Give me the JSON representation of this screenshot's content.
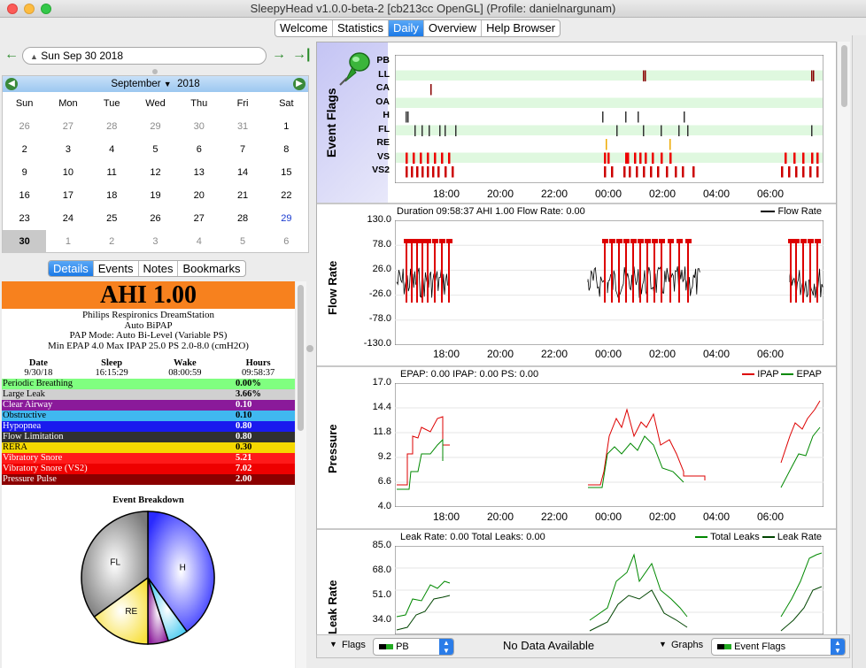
{
  "window": {
    "title": "SleepyHead v1.0.0-beta-2 [cb213cc OpenGL] (Profile: danielnargunam)"
  },
  "main_tabs": [
    "Welcome",
    "Statistics",
    "Daily",
    "Overview",
    "Help Browser"
  ],
  "main_tab_active": "Daily",
  "date_nav": {
    "date": "Sun Sep 30 2018",
    "prev_glyph": "←",
    "next_glyph": "→",
    "last_glyph": "→|"
  },
  "calendar": {
    "month": "September",
    "year": "2018",
    "days_of_week": [
      "Sun",
      "Mon",
      "Tue",
      "Wed",
      "Thu",
      "Fri",
      "Sat"
    ],
    "weeks": [
      [
        "26",
        "27",
        "28",
        "29",
        "30",
        "31",
        "1"
      ],
      [
        "2",
        "3",
        "4",
        "5",
        "6",
        "7",
        "8"
      ],
      [
        "9",
        "10",
        "11",
        "12",
        "13",
        "14",
        "15"
      ],
      [
        "16",
        "17",
        "18",
        "19",
        "20",
        "21",
        "22"
      ],
      [
        "23",
        "24",
        "25",
        "26",
        "27",
        "28",
        "29"
      ],
      [
        "30",
        "1",
        "2",
        "3",
        "4",
        "5",
        "6"
      ]
    ],
    "selected": "30"
  },
  "detail_tabs": [
    "Details",
    "Events",
    "Notes",
    "Bookmarks"
  ],
  "detail_tab_active": "Details",
  "details": {
    "ahi": "AHI 1.00",
    "machine": "Philips Respironics DreamStation",
    "model": "Auto BiPAP",
    "mode": "PAP Mode: Auto Bi-Level (Variable PS)",
    "settings": "Min EPAP 4.0 Max IPAP 25.0 PS 2.0-8.0 (cmH2O)",
    "stat_headers": [
      "Date",
      "Sleep",
      "Wake",
      "Hours"
    ],
    "stat_values": [
      "9/30/18",
      "16:15:29",
      "08:00:59",
      "09:58:37"
    ],
    "events": [
      {
        "label": "Periodic Breathing",
        "value": "0.00%",
        "bg": "#80ff80",
        "fg": "#000000"
      },
      {
        "label": "Large Leak",
        "value": "3.66%",
        "bg": "#d0d0d0",
        "fg": "#000000"
      },
      {
        "label": "Clear Airway",
        "value": "0.10",
        "bg": "#8a1a9a",
        "fg": "#ffffff"
      },
      {
        "label": "Obstructive",
        "value": "0.10",
        "bg": "#40b8f0",
        "fg": "#000000"
      },
      {
        "label": "Hypopnea",
        "value": "0.80",
        "bg": "#1a1aee",
        "fg": "#ffffff"
      },
      {
        "label": "Flow Limitation",
        "value": "0.80",
        "bg": "#303030",
        "fg": "#ffffff"
      },
      {
        "label": "RERA",
        "value": "0.30",
        "bg": "#f5d800",
        "fg": "#000000"
      },
      {
        "label": "Vibratory Snore",
        "value": "5.21",
        "bg": "#ff1a1a",
        "fg": "#ffffff"
      },
      {
        "label": "Vibratory Snore (VS2)",
        "value": "7.02",
        "bg": "#ee0000",
        "fg": "#ffffff"
      },
      {
        "label": "Pressure Pulse",
        "value": "2.00",
        "bg": "#8b0000",
        "fg": "#ffffff"
      }
    ],
    "pie_title": "Event Breakdown",
    "pie": [
      {
        "label": "H",
        "share": 0.4,
        "color": "#2a2aff"
      },
      {
        "label": "",
        "share": 0.05,
        "color": "#40c8f0"
      },
      {
        "label": "",
        "share": 0.05,
        "color": "#8a1a9a"
      },
      {
        "label": "RE",
        "share": 0.15,
        "color": "#f8e040"
      },
      {
        "label": "FL",
        "share": 0.35,
        "color": "#7a7a7a"
      }
    ]
  },
  "graphs": {
    "x_ticks": [
      "18:00",
      "20:00",
      "22:00",
      "00:00",
      "02:00",
      "04:00",
      "06:00"
    ],
    "event_flags": {
      "title": "Event Flags",
      "rows": [
        "PB",
        "LL",
        "CA",
        "OA",
        "H",
        "FL",
        "RE",
        "VS",
        "VS2"
      ]
    },
    "flow_rate": {
      "title": "Flow Rate",
      "caption": "Duration 09:58:37 AHI 1.00 Flow Rate: 0.00",
      "legend": "Flow Rate",
      "y_ticks": [
        "130.0",
        "78.0",
        "26.0",
        "-26.0",
        "-78.0",
        "-130.0"
      ]
    },
    "pressure": {
      "title": "Pressure",
      "caption": "EPAP: 0.00 IPAP: 0.00 PS: 0.00",
      "legend_ipap": "IPAP",
      "legend_epap": "EPAP",
      "y_ticks": [
        "17.0",
        "14.4",
        "11.8",
        "9.2",
        "6.6",
        "4.0"
      ]
    },
    "leak_rate": {
      "title": "Leak Rate",
      "caption": "Leak Rate: 0.00 Total Leaks: 0.00",
      "legend_total": "Total Leaks",
      "legend_leak": "Leak Rate",
      "y_ticks": [
        "85.0",
        "68.0",
        "51.0",
        "34.0"
      ]
    }
  },
  "bottom": {
    "flags_label": "Flags",
    "flags_value": "PB",
    "status": "No Data Available",
    "graphs_label": "Graphs",
    "graphs_value": "Event Flags"
  }
}
